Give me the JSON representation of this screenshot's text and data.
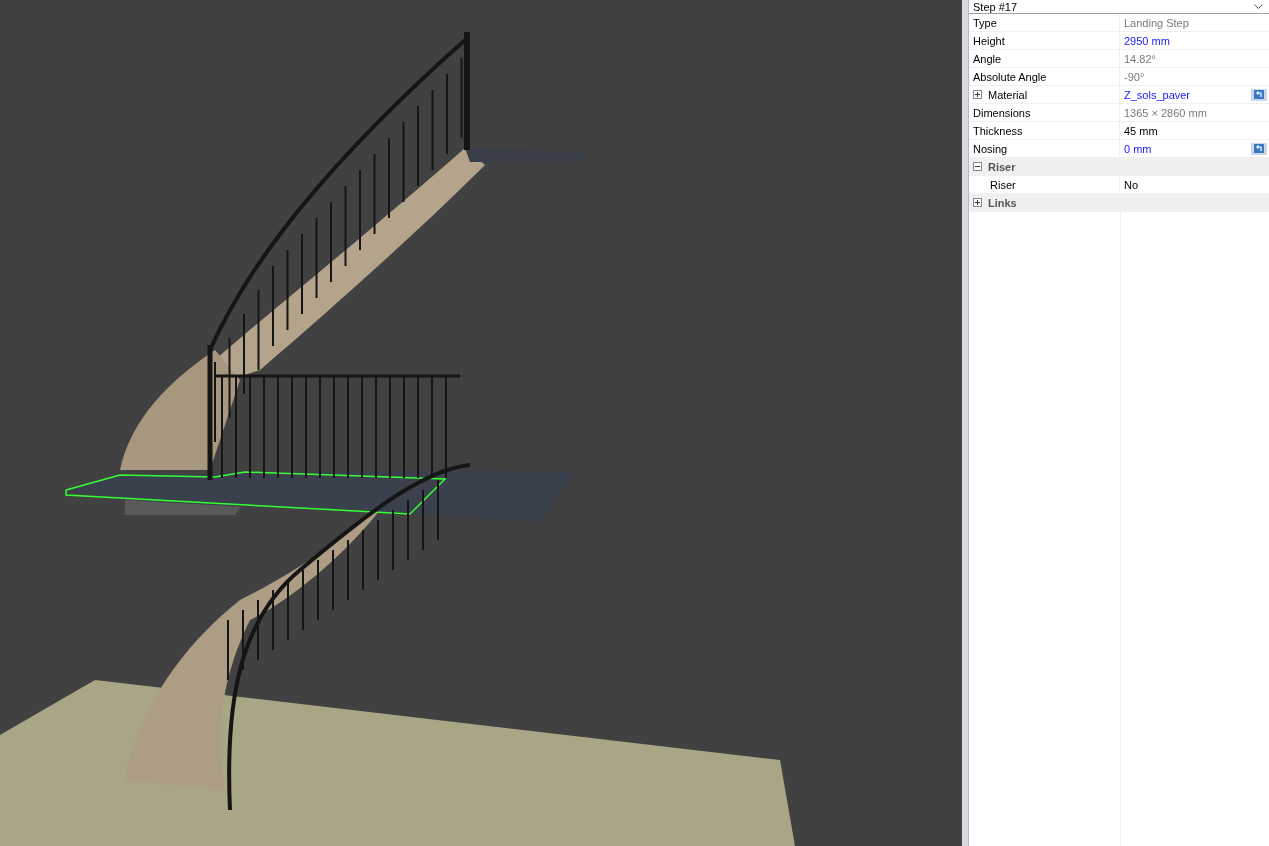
{
  "selector": {
    "value": "Step #17"
  },
  "properties": [
    {
      "kind": "property",
      "name": "Type",
      "value": "Landing Step",
      "readonly": true,
      "resettable": false
    },
    {
      "kind": "property",
      "name": "Height",
      "value": "2950 mm",
      "readonly": false,
      "modified": true,
      "resettable": false
    },
    {
      "kind": "property",
      "name": "Angle",
      "value": "14.82°",
      "readonly": true,
      "resettable": false
    },
    {
      "kind": "property",
      "name": "Absolute Angle",
      "value": "-90°",
      "readonly": true,
      "resettable": false
    },
    {
      "kind": "property",
      "name": "Material",
      "value": "Z_sols_paver",
      "readonly": false,
      "modified": true,
      "resettable": true,
      "expanded": false
    },
    {
      "kind": "property",
      "name": "Dimensions",
      "value": "1365 × 2860 mm",
      "readonly": true,
      "resettable": false
    },
    {
      "kind": "property",
      "name": "Thickness",
      "value": "45 mm",
      "readonly": false,
      "modified": false,
      "resettable": false
    },
    {
      "kind": "property",
      "name": "Nosing",
      "value": "0 mm",
      "readonly": false,
      "modified": true,
      "resettable": true
    },
    {
      "kind": "category",
      "name": "Riser",
      "expanded": true,
      "children": [
        {
          "kind": "property",
          "name": "Riser",
          "value": "No",
          "readonly": false,
          "modified": false,
          "resettable": false
        }
      ]
    },
    {
      "kind": "category",
      "name": "Links",
      "expanded": false
    }
  ]
}
